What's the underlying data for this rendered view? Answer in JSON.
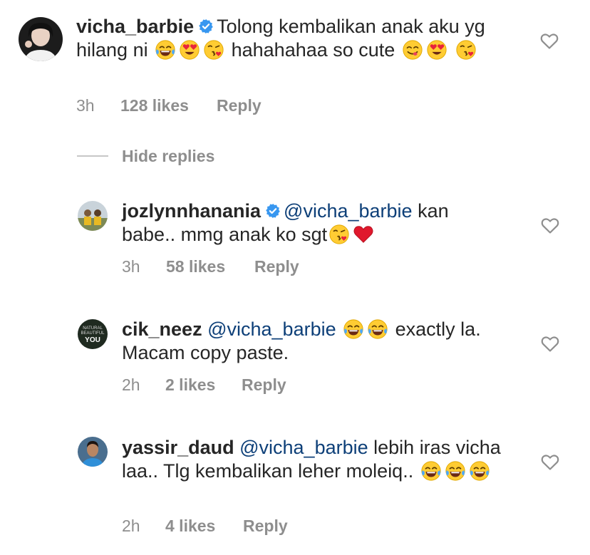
{
  "comments": [
    {
      "username": "vicha_barbie",
      "verified": true,
      "text_parts": [
        "Tolong kembalikan anak aku yg hilang ni",
        "hahahahaa so cute"
      ],
      "time": "3h",
      "likes": "128 likes",
      "reply": "Reply"
    },
    {
      "username": "jozlynnhanania",
      "verified": true,
      "mention": "@vicha_barbie",
      "text_parts": [
        "kan",
        "babe.. mmg anak ko sgt"
      ],
      "time": "3h",
      "likes": "58 likes",
      "reply": "Reply"
    },
    {
      "username": "cik_neez",
      "verified": false,
      "mention": "@vicha_barbie",
      "text_parts": [
        "exactly la.",
        "Macam copy paste."
      ],
      "avatar_text": [
        "NATURAL",
        "BEAUTIFUL",
        "YOU"
      ],
      "time": "2h",
      "likes": "2 likes",
      "reply": "Reply"
    },
    {
      "username": "yassir_daud",
      "verified": false,
      "mention": "@vicha_barbie",
      "text_parts": [
        "lebih iras",
        "vicha laa.. Tlg kembalikan leher moleiq.."
      ],
      "time": "2h",
      "likes": "4 likes",
      "reply": "Reply"
    }
  ],
  "hide_replies": "Hide replies",
  "icons": {
    "heart": "heart-outline-icon",
    "verified": "verified-badge-icon",
    "emoji_laugh": "face-with-tears-of-joy",
    "emoji_heart_eyes": "smiling-face-with-heart-eyes",
    "emoji_kiss": "face-blowing-a-kiss",
    "emoji_yum": "face-savoring-food",
    "emoji_red_heart": "red-heart"
  },
  "colors": {
    "text": "#262626",
    "meta": "#8e8e8e",
    "mention": "#0d3f78",
    "verified": "#3897f0"
  }
}
